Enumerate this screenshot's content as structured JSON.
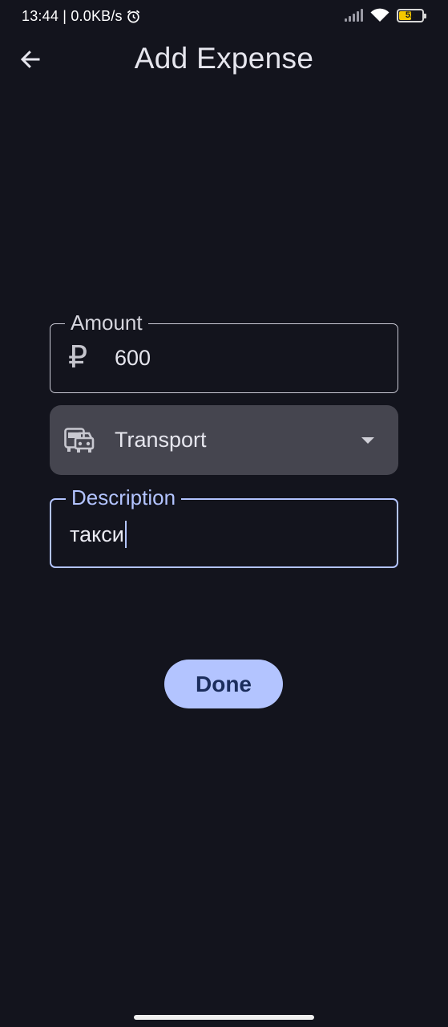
{
  "status_bar": {
    "time_and_speed": "13:44 | 0.0KB/s",
    "icons": [
      "alarm-icon",
      "signal-icon",
      "wifi-icon",
      "battery-icon"
    ],
    "battery_level": "52",
    "battery_fraction": 0.52
  },
  "app_bar": {
    "back_icon": "arrow-left-icon",
    "title": "Add Expense"
  },
  "form": {
    "amount": {
      "label": "Amount",
      "currency_symbol": "₽",
      "value": "600"
    },
    "category": {
      "icon": "transport-icon",
      "value": "Transport",
      "dropdown_icon": "arrow-drop-down-icon"
    },
    "description": {
      "label": "Description",
      "value": "такси",
      "focused": true
    },
    "done_label": "Done"
  },
  "colors": {
    "background": "#13141d",
    "accent": "#b3c4ff",
    "select_fill": "#45454f",
    "button_text": "#1b2d5c"
  }
}
